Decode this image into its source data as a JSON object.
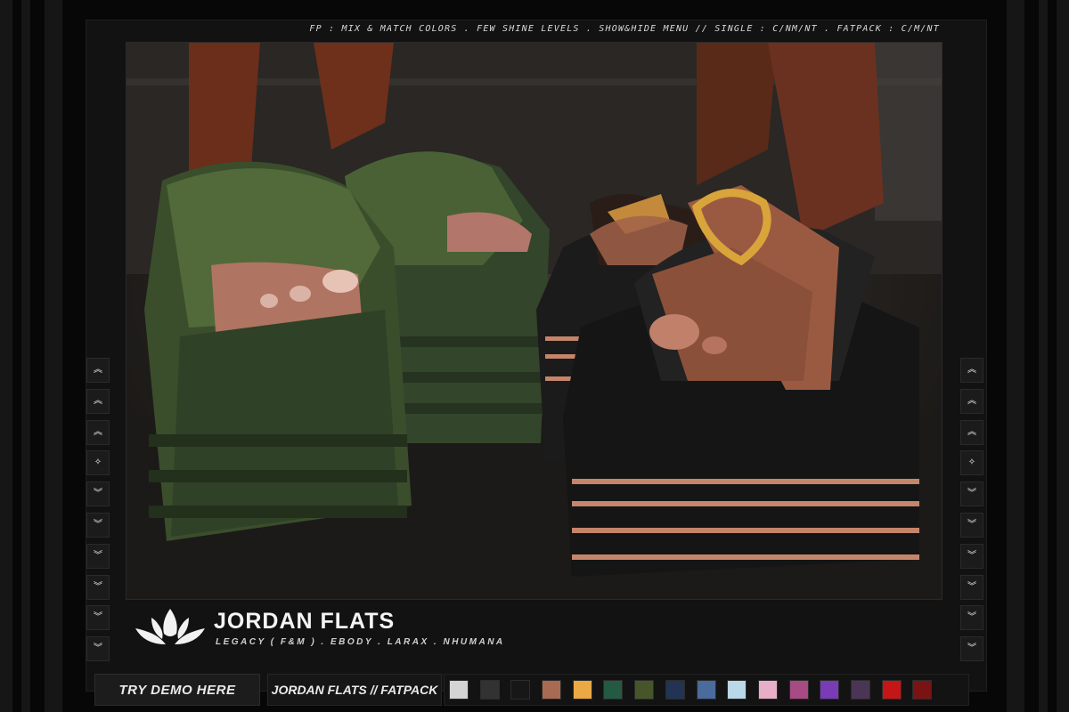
{
  "info_line": "FP : MIX & MATCH COLORS . FEW SHINE LEVELS . SHOW&HIDE MENU // SINGLE : C/NM/NT . FATPACK : C/M/NT",
  "product": {
    "title": "JORDAN FLATS",
    "subtitle": "LEGACY ( F&M ) . EBODY . LARAX . NHUMANA"
  },
  "buttons": {
    "demo_label": "TRY DEMO HERE",
    "pack_label": "JORDAN FLATS // FATPACK"
  },
  "side_arrows": [
    {
      "icon": "double-chevron-up-icon",
      "glyph": "︽"
    },
    {
      "icon": "double-chevron-up-icon",
      "glyph": "︽"
    },
    {
      "icon": "double-chevron-up-icon",
      "glyph": "︽"
    },
    {
      "icon": "sparkle-icon",
      "glyph": "✧"
    },
    {
      "icon": "double-chevron-down-icon",
      "glyph": "︾"
    },
    {
      "icon": "double-chevron-down-icon",
      "glyph": "︾"
    },
    {
      "icon": "double-chevron-down-icon",
      "glyph": "︾"
    },
    {
      "icon": "double-chevron-down-icon",
      "glyph": "︾"
    },
    {
      "icon": "double-chevron-down-icon",
      "glyph": "︾"
    },
    {
      "icon": "double-chevron-down-icon",
      "glyph": "︾"
    }
  ],
  "swatches": [
    "#d4d4d4",
    "#323232",
    "#171717",
    "#a86a52",
    "#eaa944",
    "#245a41",
    "#46562a",
    "#223353",
    "#4a6b9c",
    "#b9d8e8",
    "#e8aec8",
    "#a84a84",
    "#7a3bb6",
    "#4a3654",
    "#c41616",
    "#7a1414"
  ],
  "colors": {
    "accent_green": "#3e5230",
    "leather_black": "#1a1a1a",
    "strap_brown": "#9a5a42"
  }
}
